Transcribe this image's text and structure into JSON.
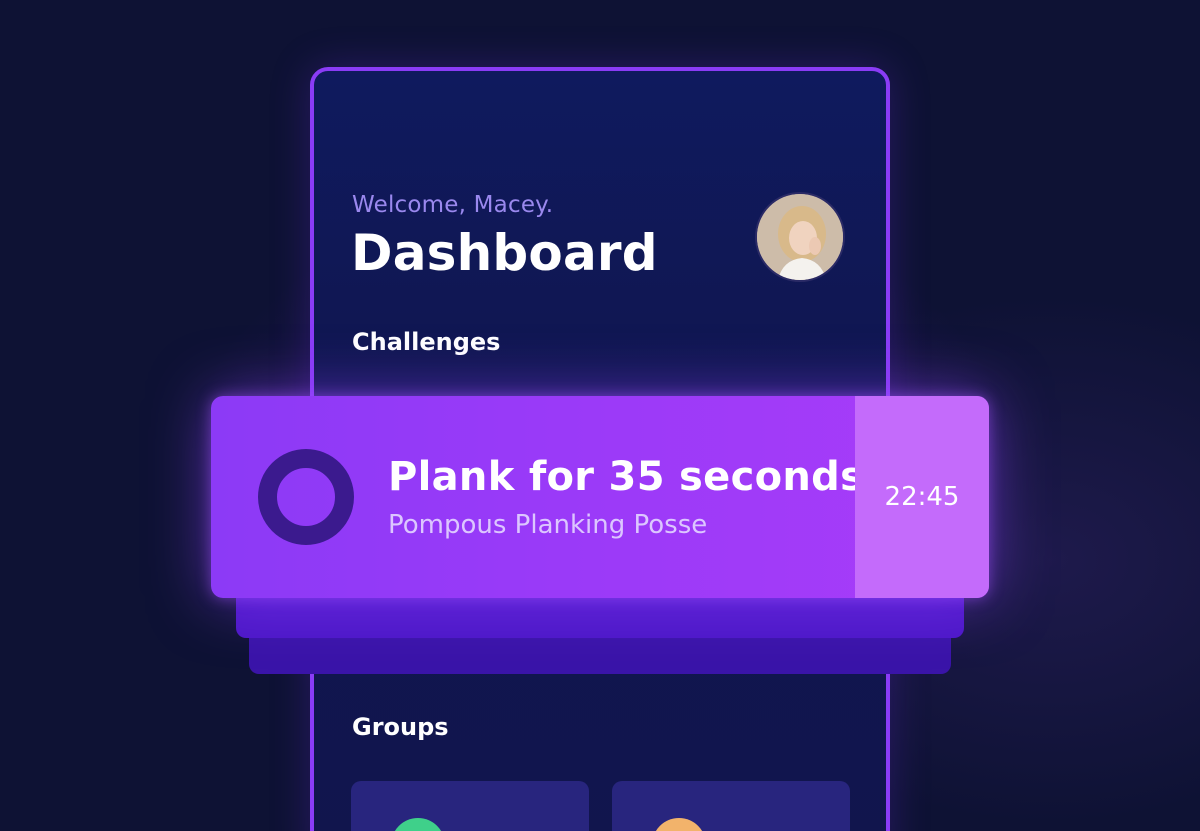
{
  "header": {
    "welcome_text": "Welcome, Macey.",
    "title": "Dashboard",
    "avatar_icon": "user-avatar"
  },
  "sections": {
    "challenges_label": "Challenges",
    "groups_label": "Groups"
  },
  "challenge": {
    "title": "Plank for 35 seconds",
    "group": "Pompous Planking Posse",
    "timer": "22:45",
    "status_icon": "ring-icon"
  },
  "groups": [
    {
      "icon": "group-avatar",
      "color": "#3fd08a"
    },
    {
      "icon": "group-avatar",
      "color": "#f2b36b"
    }
  ],
  "colors": {
    "accent": "#8a3cf6",
    "card": "#9a3af8",
    "timer_panel": "#c46bfb",
    "background": "#0e1234"
  }
}
